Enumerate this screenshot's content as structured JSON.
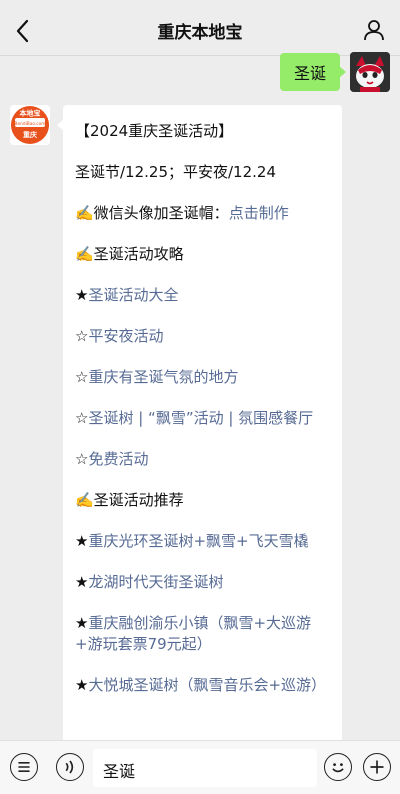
{
  "header": {
    "title": "重庆本地宝",
    "back_icon": "chevron-left-icon",
    "profile_icon": "person-outline-icon"
  },
  "outgoing_message": {
    "text": "圣诞",
    "bubble_color": "#95ec69"
  },
  "bot_avatar": {
    "logo_text_top": "本地宝",
    "logo_text_url": "BendiBao.com",
    "logo_text_city": "重庆",
    "accent": "#e8501c"
  },
  "incoming_message": {
    "lines": [
      {
        "parts": [
          {
            "text": "【2024重庆圣诞活动】",
            "link": false
          }
        ]
      },
      {
        "parts": [
          {
            "text": "圣诞节/12.25；平安夜/12.24",
            "link": false
          }
        ]
      },
      {
        "parts": [
          {
            "text": "✍️微信头像加圣诞帽：",
            "link": false
          },
          {
            "text": "点击制作",
            "link": true
          }
        ]
      },
      {
        "parts": [
          {
            "text": "✍️圣诞活动攻略",
            "link": false
          }
        ]
      },
      {
        "parts": [
          {
            "text": "★",
            "link": false
          },
          {
            "text": "圣诞活动大全",
            "link": true
          }
        ]
      },
      {
        "parts": [
          {
            "text": "☆",
            "link": false
          },
          {
            "text": "平安夜活动",
            "link": true
          }
        ]
      },
      {
        "parts": [
          {
            "text": "☆",
            "link": false
          },
          {
            "text": "重庆有圣诞气氛的地方",
            "link": true
          }
        ]
      },
      {
        "parts": [
          {
            "text": "☆",
            "link": false
          },
          {
            "text": "圣诞树 | “飘雪”活动 | 氛围感餐厅",
            "link": true
          }
        ]
      },
      {
        "parts": [
          {
            "text": "☆",
            "link": false
          },
          {
            "text": "免费活动",
            "link": true
          }
        ]
      },
      {
        "parts": [
          {
            "text": "✍️圣诞活动推荐",
            "link": false
          }
        ]
      },
      {
        "parts": [
          {
            "text": "★",
            "link": false
          },
          {
            "text": "重庆光环圣诞树+飘雪+飞天雪橇",
            "link": true
          }
        ]
      },
      {
        "parts": [
          {
            "text": "★",
            "link": false
          },
          {
            "text": "龙湖时代天街圣诞树",
            "link": true
          }
        ]
      },
      {
        "parts": [
          {
            "text": "★",
            "link": false
          },
          {
            "text": "重庆融创渝乐小镇（飘雪+大巡游+游玩套票79元起）",
            "link": true
          }
        ]
      },
      {
        "parts": [
          {
            "text": "★",
            "link": false
          },
          {
            "text": "大悦城圣诞树（飘雪音乐会+巡游）",
            "link": true
          }
        ]
      }
    ],
    "link_color": "#576b95"
  },
  "input_bar": {
    "value": "圣诞",
    "voice_icon": "voice-wave-icon",
    "emoji_icon": "emoji-face-icon",
    "plus_icon": "plus-circle-icon",
    "menu_icon": "list-menu-icon"
  }
}
